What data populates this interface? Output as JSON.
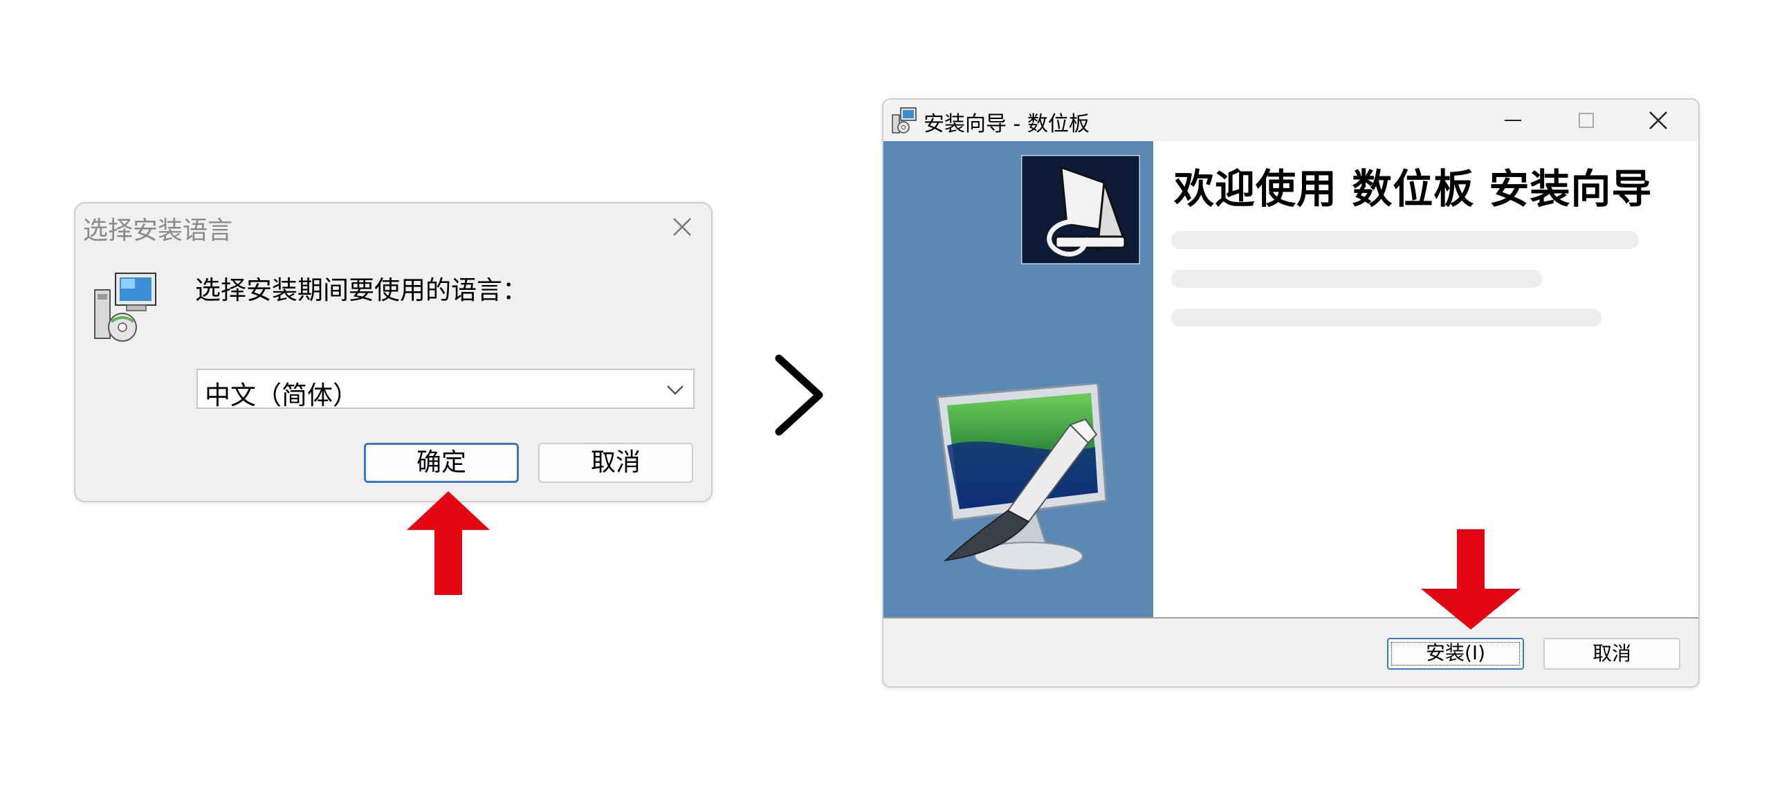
{
  "lang_dialog": {
    "title": "选择安装语言",
    "prompt": "选择安装期间要使用的语言：",
    "selected_language": "中文（简体）",
    "ok_label": "确定",
    "cancel_label": "取消"
  },
  "wizard": {
    "title": "安装向导 - 数位板",
    "heading": "欢迎使用 数位板 安装向导",
    "install_label": "安装(I)",
    "cancel_label": "取消"
  },
  "colors": {
    "arrow": "#e30613",
    "sidebar": "#5a89b6",
    "focus_border": "#3b78c4"
  },
  "icons": [
    "close-icon",
    "installer-icon",
    "chevron-down-icon",
    "next-arrow-icon",
    "minimize-icon",
    "maximize-icon",
    "red-arrow-icon"
  ]
}
